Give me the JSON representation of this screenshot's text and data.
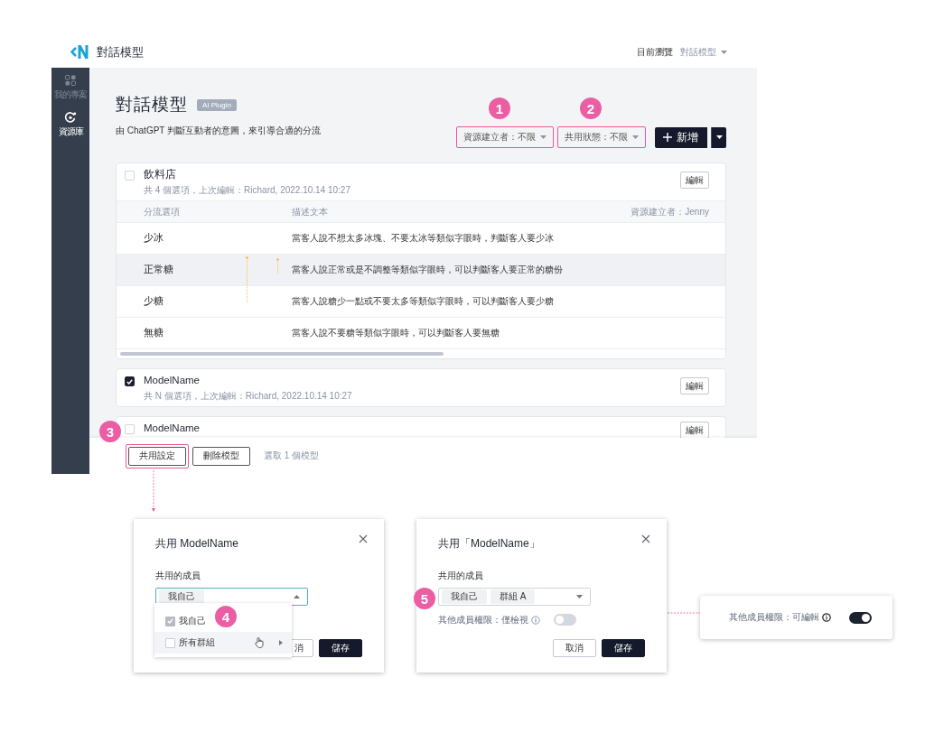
{
  "header": {
    "logo": "對話模型",
    "breadcrumb_label": "目前瀏覽",
    "breadcrumb_current": "對話模型"
  },
  "sidebar": {
    "items": [
      {
        "label": "我的專案",
        "selected": false
      },
      {
        "label": "資源庫",
        "selected": true
      }
    ]
  },
  "page": {
    "title": "對話模型",
    "tag": "AI Plugin",
    "subtitle": "由 ChatGPT 判斷互動者的意圖，來引導合適的分流",
    "filters": [
      {
        "label": "資源建立者：不限",
        "highlighted": true
      },
      {
        "label": "共用狀態：不限",
        "highlighted": true
      }
    ],
    "add_button": "新增"
  },
  "models": [
    {
      "name": "飲料店",
      "checked": false,
      "meta": "共 4 個選項，上次編輯：Richard, 2022.10.14 10:27",
      "edit": "編輯",
      "table": {
        "columns": [
          "分流選項",
          "描述文本"
        ],
        "creator": "資源建立者：Jenny",
        "rows": [
          {
            "option": "少冰",
            "description": "當客人說不想太多冰塊、不要太冰等類似字眼時，判斷客人要少冰",
            "hovered": false
          },
          {
            "option": "正常糖",
            "description": "當客人說正常或是不調整等類似字眼時，可以判斷客人要正常的糖份",
            "hovered": true
          },
          {
            "option": "少糖",
            "description": "當客人說糖少一點或不要太多等類似字眼時，可以判斷客人要少糖",
            "hovered": false
          },
          {
            "option": "無糖",
            "description": "當客人說不要糖等類似字眼時，可以判斷客人要無糖",
            "hovered": false
          }
        ]
      }
    },
    {
      "name": "ModelName",
      "checked": true,
      "meta": "共 N 個選項，上次編輯：Richard, 2022.10.14 10:27",
      "edit": "編輯"
    },
    {
      "name": "ModelName",
      "checked": false,
      "edit": "編輯"
    }
  ],
  "bulk_bar": {
    "buttons": [
      {
        "label": "共用設定",
        "highlighted": true
      },
      {
        "label": "刪除模型",
        "highlighted": false
      }
    ],
    "status": "選取 1 個模型"
  },
  "share_dialogs": [
    {
      "title": "共用 ModelName",
      "field_label": "共用的成員",
      "focused": true,
      "chips": [
        "我自己"
      ],
      "dropdown": {
        "items": [
          {
            "label": "我自己",
            "checked": true,
            "disabled": true,
            "hovered": false,
            "submenu": false
          },
          {
            "label": "所有群組",
            "checked": false,
            "disabled": false,
            "hovered": true,
            "submenu": true
          }
        ]
      },
      "cancel": "消",
      "save": "儲存"
    },
    {
      "title": "共用「ModelName」",
      "field_label": "共用的成員",
      "focused": false,
      "chips": [
        "我自己",
        "群組 A"
      ],
      "permission": {
        "label": "其他成員權限：僅檢視",
        "on": false
      },
      "cancel": "取消",
      "save": "儲存"
    }
  ],
  "permission_preview": {
    "label": "其他成員權限：可編輯",
    "on": true
  },
  "markers": [
    "1",
    "2",
    "3",
    "4",
    "5"
  ]
}
